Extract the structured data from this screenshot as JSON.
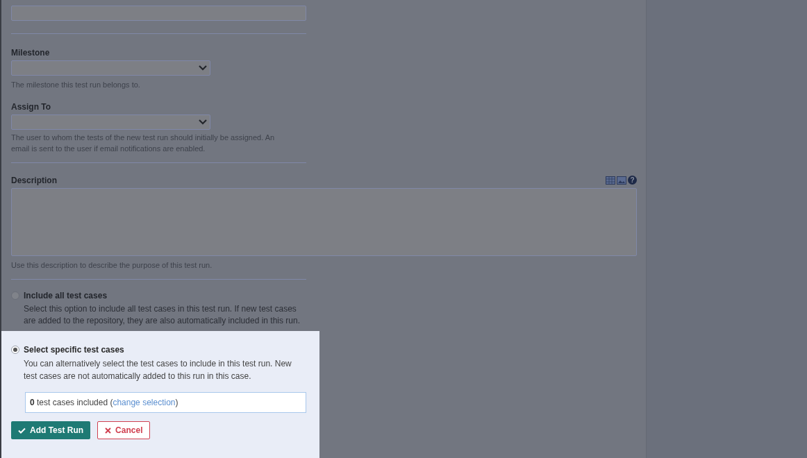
{
  "milestone": {
    "label": "Milestone",
    "hint": "The milestone this test run belongs to."
  },
  "assign_to": {
    "label": "Assign To",
    "hint": "The user to whom the tests of the new test run should initially be assigned. An email is sent to the user if email notifications are enabled."
  },
  "description": {
    "label": "Description",
    "hint": "Use this description to describe the purpose of this test run.",
    "help": "?"
  },
  "include_all": {
    "title": "Include all test cases",
    "text": "Select this option to include all test cases in this test run. If new test cases are added to the repository, they are also automatically included in this run.",
    "selected": false
  },
  "highlighted_section": {
    "option": {
      "title": "Select specific test cases",
      "text": "You can alternatively select the test cases to include in this test run. New test cases are not automatically added to this run in this case.",
      "selected": true
    },
    "selection": {
      "count": "0",
      "text": "test cases included (",
      "link": "change selection",
      "suffix": ")"
    },
    "buttons": [
      {
        "label": "Add Test Run",
        "kind": "primary"
      },
      {
        "label": "Cancel",
        "kind": "cancel"
      }
    ]
  }
}
